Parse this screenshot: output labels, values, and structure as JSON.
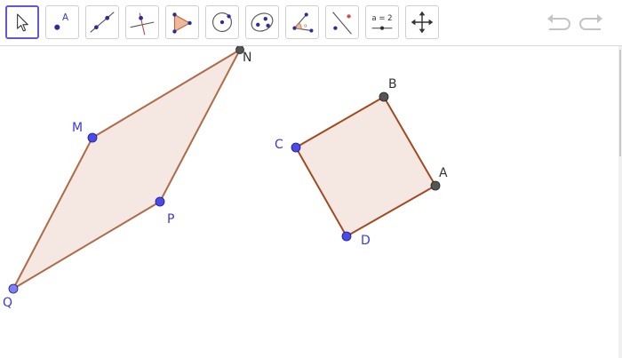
{
  "toolbar": {
    "tools": [
      {
        "name": "move"
      },
      {
        "name": "point"
      },
      {
        "name": "line"
      },
      {
        "name": "perpendicular-line"
      },
      {
        "name": "polygon"
      },
      {
        "name": "circle"
      },
      {
        "name": "ellipse"
      },
      {
        "name": "angle"
      },
      {
        "name": "reflect"
      },
      {
        "name": "slider",
        "label": "a = 2"
      },
      {
        "name": "move-graphics-view"
      }
    ],
    "selected_tool": "move"
  },
  "colors": {
    "accent": "#6557d2",
    "polygon_stroke": "#b06a45",
    "polygon_fill": "#f5e8e3",
    "free_point": "#4a4ae8",
    "dependent_point": "#555555",
    "label_blue": "#3b3bd6",
    "label_dark": "#333333"
  },
  "canvas": {
    "points": [
      {
        "label": "N",
        "kind": "dependent"
      },
      {
        "label": "M",
        "kind": "free"
      },
      {
        "label": "P",
        "kind": "free"
      },
      {
        "label": "Q",
        "kind": "free"
      },
      {
        "label": "B",
        "kind": "dependent"
      },
      {
        "label": "C",
        "kind": "free"
      },
      {
        "label": "A",
        "kind": "dependent"
      },
      {
        "label": "D",
        "kind": "free"
      }
    ],
    "polygons": [
      {
        "vertices": [
          "Q",
          "M",
          "N",
          "P"
        ]
      },
      {
        "vertices": [
          "C",
          "B",
          "A",
          "D"
        ]
      }
    ]
  }
}
